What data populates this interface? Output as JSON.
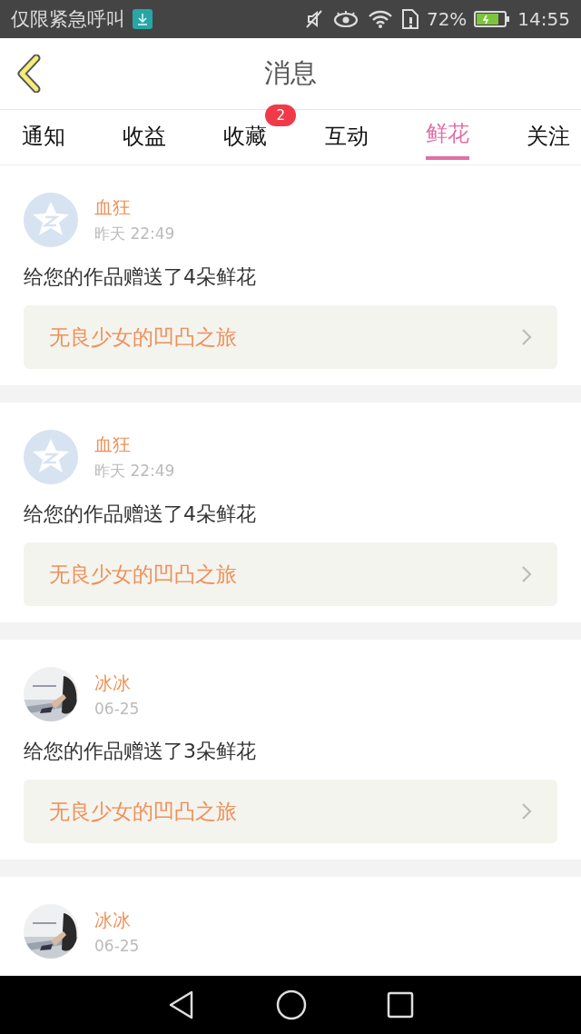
{
  "status_bar": {
    "carrier": "仅限紧急呼叫",
    "battery": "72%",
    "time": "14:55"
  },
  "header": {
    "title": "消息"
  },
  "tabs": [
    {
      "label": "通知",
      "selected": false
    },
    {
      "label": "收益",
      "selected": false
    },
    {
      "label": "收藏",
      "selected": false,
      "badge": "2"
    },
    {
      "label": "互动",
      "selected": false
    },
    {
      "label": "鲜花",
      "selected": true
    },
    {
      "label": "关注",
      "selected": false
    }
  ],
  "messages": [
    {
      "avatar": {
        "kind": "default"
      },
      "name": "血狂",
      "time": "昨天 22:49",
      "text": "给您的作品赠送了4朵鲜花",
      "work": "无良少女的凹凸之旅"
    },
    {
      "avatar": {
        "kind": "default"
      },
      "name": "血狂",
      "time": "昨天 22:49",
      "text": "给您的作品赠送了4朵鲜花",
      "work": "无良少女的凹凸之旅"
    },
    {
      "name": "冰冰",
      "time": "06-25",
      "text": "给您的作品赠送了3朵鲜花",
      "work": "无良少女的凹凸之旅"
    },
    {
      "name": "冰冰",
      "time": "06-25"
    }
  ]
}
